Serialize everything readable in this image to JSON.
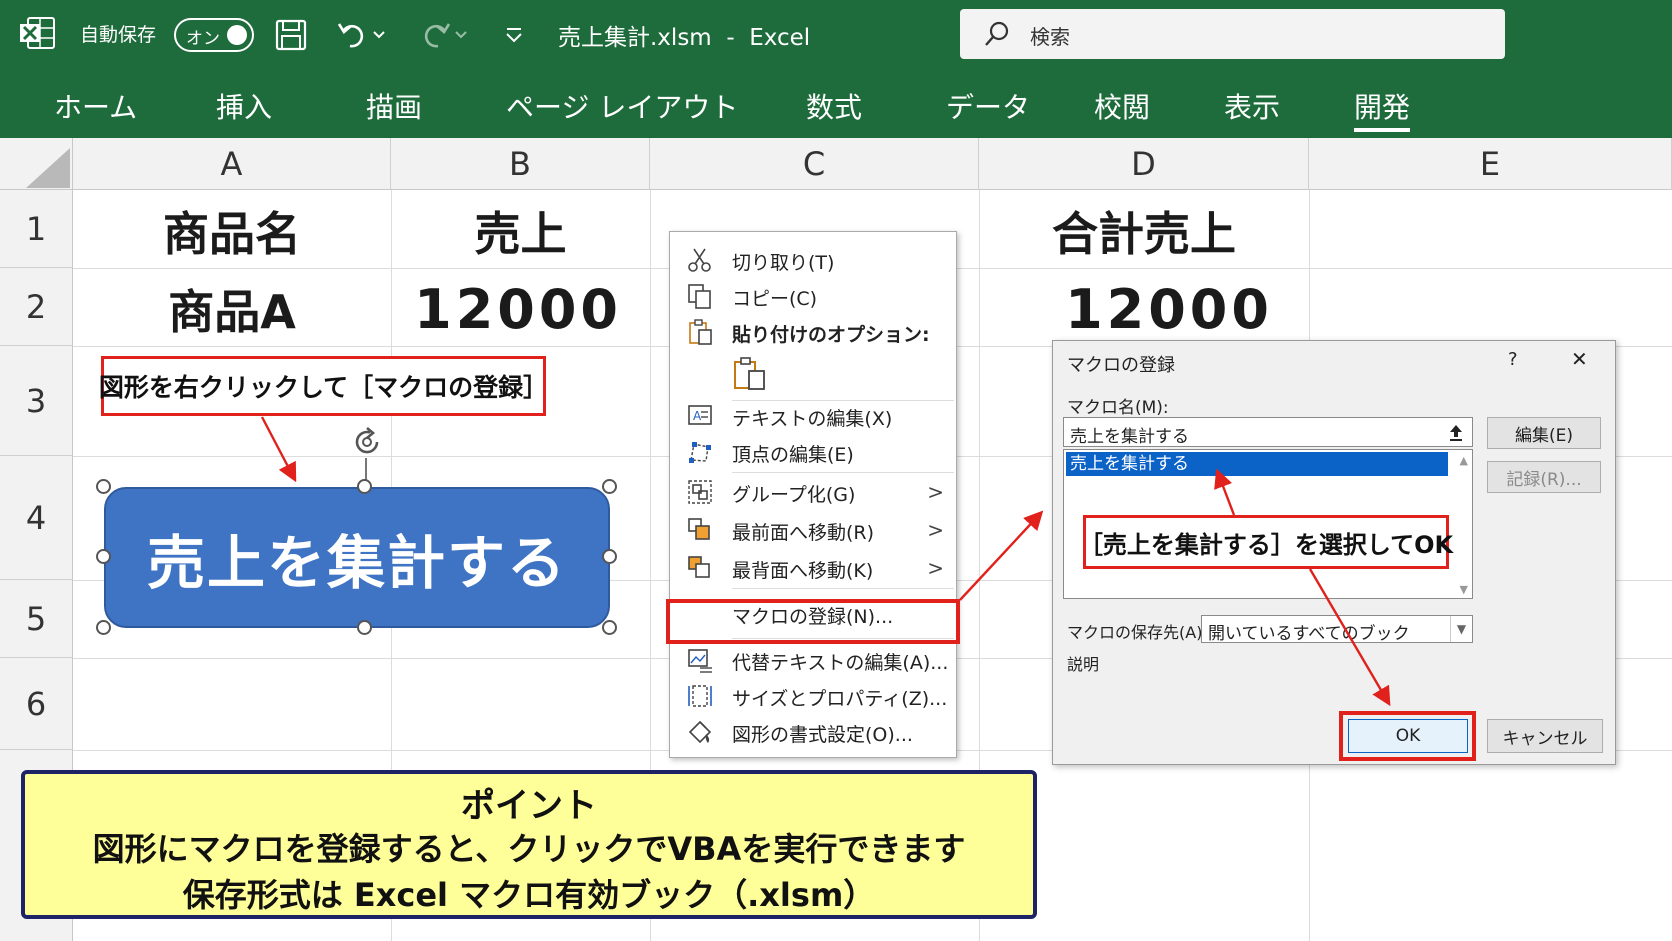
{
  "titlebar": {
    "autosave_label": "自動保存",
    "autosave_state": "オン",
    "doc_title": "売上集計.xlsm  -  Excel",
    "search_placeholder": "検索"
  },
  "ribbon": {
    "tabs": [
      "ホーム",
      "挿入",
      "描画",
      "ページ レイアウト",
      "数式",
      "データ",
      "校閲",
      "表示",
      "開発"
    ],
    "active_tab": "開発"
  },
  "sheet": {
    "columns": [
      "A",
      "B",
      "C",
      "D",
      "E"
    ],
    "rows": [
      "1",
      "2",
      "3",
      "4",
      "5",
      "6"
    ],
    "cells": {
      "A1": "商品名",
      "B1": "売上",
      "D1": "合計売上",
      "A2": "商品A",
      "B2": "12000",
      "D2": "12000"
    }
  },
  "callouts": {
    "right_click": "図形を右クリックして［マクロの登録］",
    "select_ok": "［売上を集計する］を選択してOK"
  },
  "shape": {
    "label": "売上を集計する"
  },
  "context_menu": {
    "items": [
      {
        "label": "切り取り(T)",
        "icon": "scissors-icon"
      },
      {
        "label": "コピー(C)",
        "icon": "copy-icon"
      },
      {
        "label": "貼り付けのオプション:",
        "icon": "paste-icon"
      },
      {
        "label": "テキストの編集(X)",
        "icon": "text-edit-icon"
      },
      {
        "label": "頂点の編集(E)",
        "icon": "edit-points-icon"
      },
      {
        "label": "グループ化(G)",
        "icon": "group-icon"
      },
      {
        "label": "最前面へ移動(R)",
        "icon": "bring-front-icon"
      },
      {
        "label": "最背面へ移動(K)",
        "icon": "send-back-icon"
      },
      {
        "label": "マクロの登録(N)...",
        "icon": ""
      },
      {
        "label": "代替テキストの編集(A)...",
        "icon": "alt-text-icon"
      },
      {
        "label": "サイズとプロパティ(Z)...",
        "icon": "size-icon"
      },
      {
        "label": "図形の書式設定(O)...",
        "icon": "format-shape-icon"
      }
    ],
    "submenu_arrow": ">"
  },
  "dialog": {
    "title": "マクロの登録",
    "help": "?",
    "close": "✕",
    "macro_name_label": "マクロ名(M):",
    "macro_name_value": "売上を集計する",
    "macro_list": [
      "売上を集計する"
    ],
    "edit_button": "編集(E)",
    "record_button": "記録(R)...",
    "macros_in_label": "マクロの保存先(A):",
    "macros_in_value": "開いているすべてのブック",
    "description_label": "説明",
    "ok_button": "OK",
    "cancel_button": "キャンセル"
  },
  "point": {
    "heading": "ポイント",
    "line1": "図形にマクロを登録すると、クリックでVBAを実行できます",
    "line2": "保存形式は Excel マクロ有効ブック（.xlsm）"
  },
  "colors": {
    "excel_green": "#1e6b3c",
    "shape_blue": "#3f73c4",
    "highlight_red": "#e0211c",
    "note_yellow": "#ffff99",
    "note_border": "#1d2466",
    "selection_blue": "#0b63c8"
  }
}
